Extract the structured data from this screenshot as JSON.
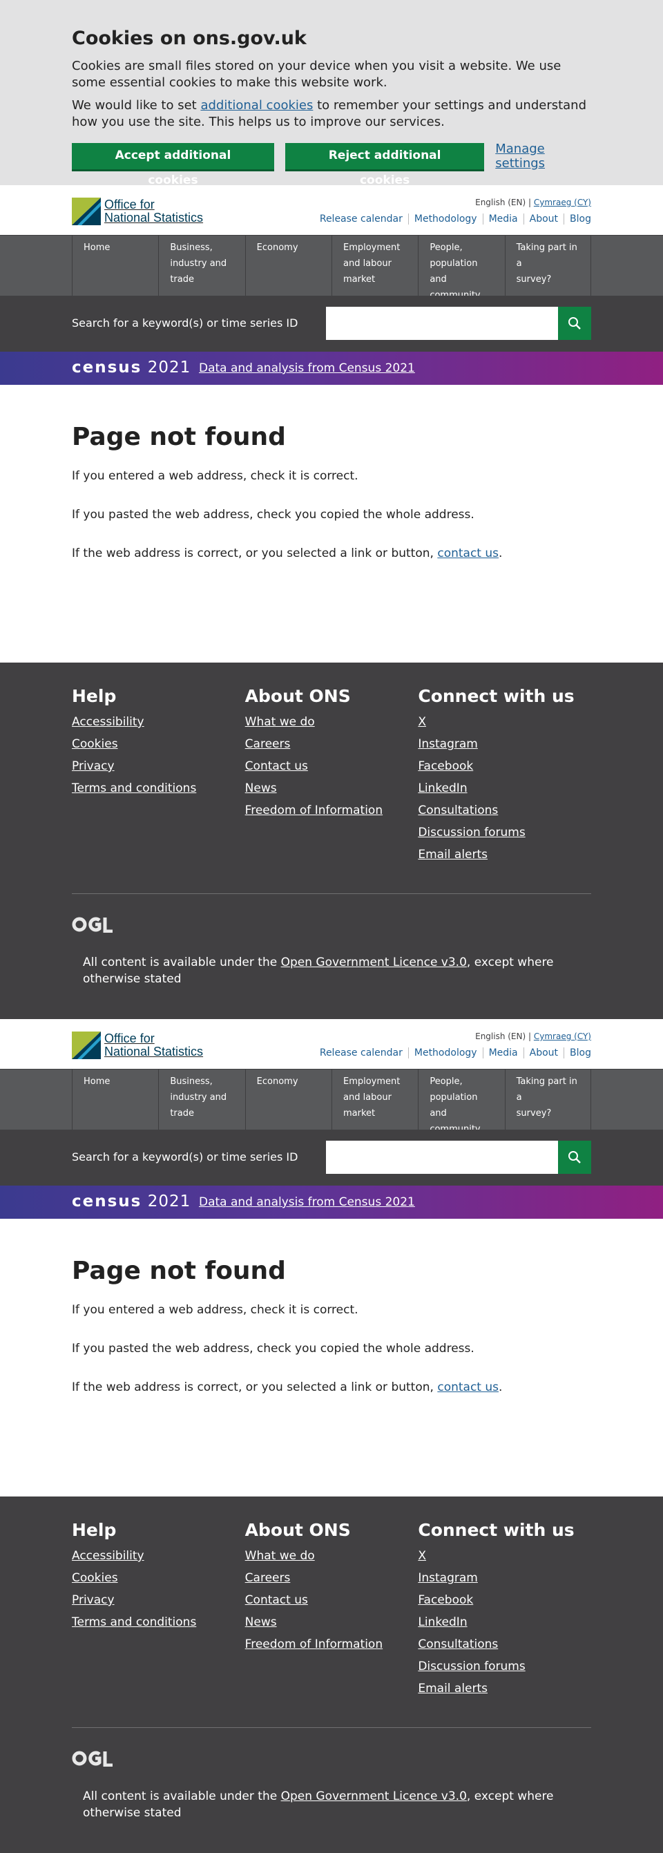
{
  "cookie_banner": {
    "title": "Cookies on ons.gov.uk",
    "para1": "Cookies are small files stored on your device when you visit a website. We use some essential cookies to make this website work.",
    "para2_before": "We would like to set ",
    "para2_link": "additional cookies",
    "para2_after": " to remember your settings and understand how you use the site. This helps us to improve our services.",
    "accept_label": "Accept additional cookies",
    "reject_label": "Reject additional cookies",
    "manage_label": "Manage settings"
  },
  "header": {
    "logo_line1": "Office for",
    "logo_line2": "National Statistics",
    "lang_en": "English (EN)",
    "lang_sep": " | ",
    "lang_cy": "Cymraeg (CY)",
    "links": [
      "Release calendar",
      "Methodology",
      "Media",
      "About",
      "Blog"
    ]
  },
  "nav": {
    "items": [
      [
        "Home"
      ],
      [
        "Business,",
        "industry and",
        "trade"
      ],
      [
        "Economy"
      ],
      [
        "Employment",
        "and labour",
        "market"
      ],
      [
        "People,",
        "population and",
        "community"
      ],
      [
        "Taking part in a",
        "survey?"
      ]
    ]
  },
  "search": {
    "label": "Search for a keyword(s) or time series ID",
    "value": "",
    "icon": "search-icon"
  },
  "census": {
    "logo_word": "census",
    "logo_year": "2021",
    "link_text": "Data and analysis from Census 2021"
  },
  "main": {
    "title": "Page not found",
    "para1": "If you entered a web address, check it is correct.",
    "para2": "If you pasted the web address, check you copied the whole address.",
    "para3_before": "If the web address is correct, or you selected a link or button, ",
    "para3_link": "contact us",
    "para3_after": "."
  },
  "footer": {
    "help": {
      "heading": "Help",
      "links": [
        "Accessibility",
        "Cookies",
        "Privacy",
        "Terms and conditions"
      ]
    },
    "about": {
      "heading": "About ONS",
      "links": [
        "What we do",
        "Careers",
        "Contact us",
        "News",
        "Freedom of Information"
      ]
    },
    "connect": {
      "heading": "Connect with us",
      "links": [
        "X",
        "Instagram",
        "Facebook",
        "LinkedIn",
        "Consultations",
        "Discussion forums",
        "Email alerts"
      ]
    },
    "ogl_logo": "OGL",
    "licence_before": "All content is available under the ",
    "licence_link": "Open Government Licence v3.0",
    "licence_after": ", except where otherwise stated"
  },
  "colors": {
    "brand_green": "#0f8243",
    "link_blue": "#206095",
    "footer_bg": "#414042",
    "nav_bg": "#58595b",
    "census_gradient_start": "#3b3a8f",
    "census_gradient_end": "#902082"
  }
}
